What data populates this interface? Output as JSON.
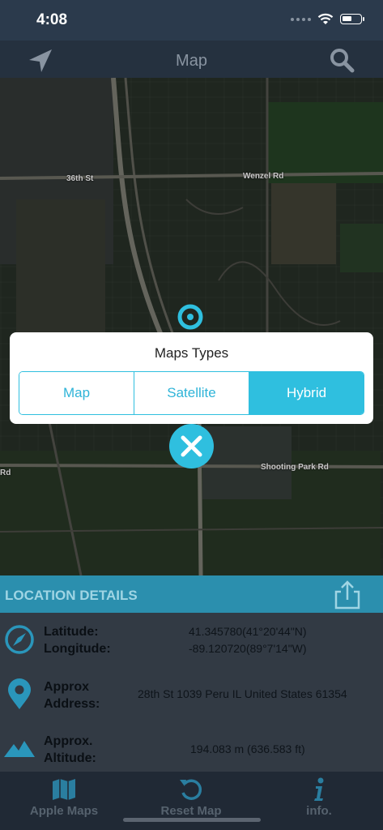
{
  "status_bar": {
    "time": "4:08",
    "battery_level": 0.55
  },
  "nav": {
    "title": "Map",
    "left_icon": "location-arrow-icon",
    "right_icon": "search-icon"
  },
  "map": {
    "labels": [
      "36th St",
      "Wenzel Rd",
      "Shooting Park Rd",
      "Rd"
    ],
    "pin_icon": "map-pin-icon"
  },
  "dialog": {
    "title": "Maps Types",
    "options": [
      "Map",
      "Satellite",
      "Hybrid"
    ],
    "selected": "Hybrid",
    "close_icon": "close-icon"
  },
  "details": {
    "header": "LOCATION DETAILS",
    "share_icon": "share-icon",
    "rows": [
      {
        "icon": "compass-icon",
        "label_line1": "Latitude:",
        "label_line2": "Longitude:",
        "value_line1": "41.345780(41°20'44\"N)",
        "value_line2": "-89.120720(89°7'14\"W)"
      },
      {
        "icon": "location-pin-icon",
        "label_line1": "Approx",
        "label_line2": "Address:",
        "value_line1": "28th St 1039 Peru  IL United States 61354"
      },
      {
        "icon": "mountain-icon",
        "label_line1": "Approx.",
        "label_line2": "Altitude:",
        "value_line1": "194.083 m (636.583 ft)"
      }
    ]
  },
  "tabs": [
    {
      "label": "Apple Maps",
      "icon": "map-icon"
    },
    {
      "label": "Reset Map",
      "icon": "reset-icon"
    },
    {
      "label": "info.",
      "icon": "info-icon"
    }
  ],
  "colors": {
    "accent": "#2fbfdf",
    "header_blue": "#2b8fae",
    "nav_bg": "#25313f"
  }
}
